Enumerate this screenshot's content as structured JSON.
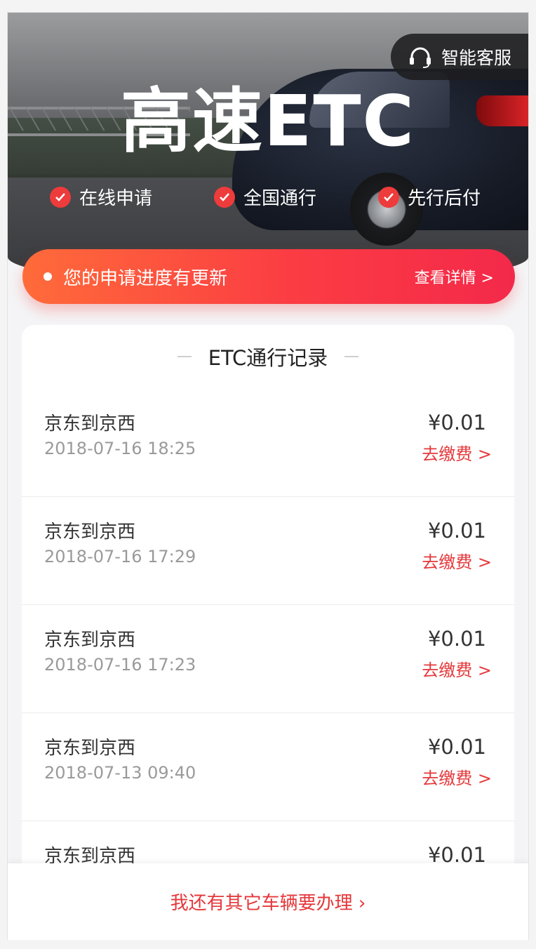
{
  "hero": {
    "title": "高速ETC",
    "service_label": "智能客服",
    "features": [
      "在线申请",
      "全国通行",
      "先行后付"
    ]
  },
  "notice": {
    "message": "您的申请进度有更新",
    "detail_link": "查看详情 >"
  },
  "records": {
    "title": "ETC通行记录",
    "items": [
      {
        "route": "京东到京西",
        "time": "2018-07-16 18:25",
        "amount": "¥0.01",
        "action": "去缴费 >"
      },
      {
        "route": "京东到京西",
        "time": "2018-07-16 17:29",
        "amount": "¥0.01",
        "action": "去缴费 >"
      },
      {
        "route": "京东到京西",
        "time": "2018-07-16 17:23",
        "amount": "¥0.01",
        "action": "去缴费 >"
      },
      {
        "route": "京东到京西",
        "time": "2018-07-13 09:40",
        "amount": "¥0.01",
        "action": "去缴费 >"
      },
      {
        "route": "京东到京西",
        "time": "",
        "amount": "¥0.01",
        "action": ""
      }
    ]
  },
  "bottom": {
    "other_vehicle_label": "我还有其它车辆要办理 ›"
  },
  "colors": {
    "accent_red": "#e5383b",
    "gradient_start": "#ff6b3a",
    "gradient_end": "#f4294a"
  }
}
